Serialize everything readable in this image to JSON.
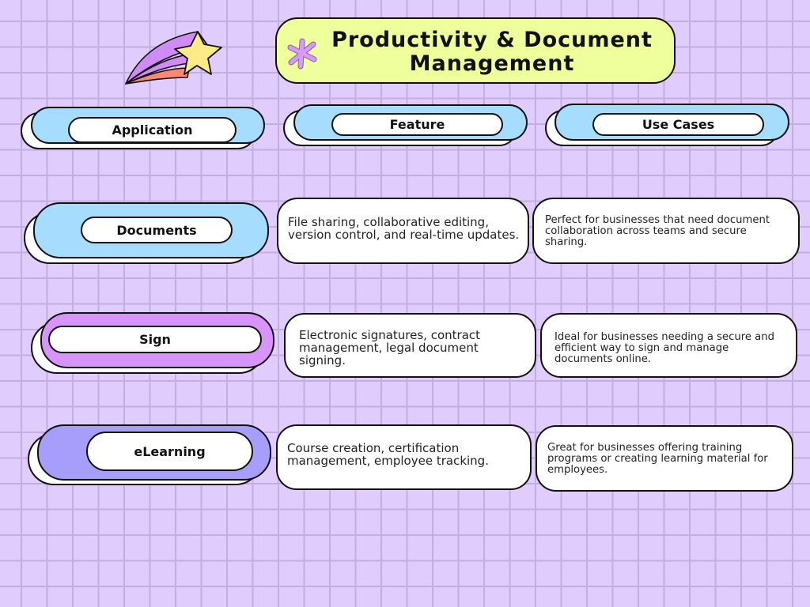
{
  "title": {
    "line1": "Productivity & Document",
    "line2": "Management"
  },
  "decorations": {
    "shooting_star": "shooting-star-icon",
    "asterisk": "asterisk-icon"
  },
  "colors": {
    "background": "#e0ccfd",
    "grid": "#c3aee0",
    "title_bg": "#efff9b",
    "header_blue": "#a6dcfd",
    "sign_purple": "#d794fa",
    "elearning_violet": "#a79dfb",
    "star_yellow": "#ffeb86",
    "tail_purple": "#cf8cf7",
    "tail_coral": "#fb8777"
  },
  "headers": {
    "application": "Application",
    "feature": "Feature",
    "use_cases": "Use Cases"
  },
  "rows": [
    {
      "application": "Documents",
      "feature": "File sharing, collaborative editing, version control, and real-time updates.",
      "use_case": "Perfect for businesses that need document collaboration across teams and secure sharing."
    },
    {
      "application": "Sign",
      "feature": "Electronic signatures, contract management, legal document signing.",
      "use_case": "Ideal for businesses needing a secure and efficient way to sign and manage documents online."
    },
    {
      "application": "eLearning",
      "feature": "Course creation, certification management, employee tracking.",
      "use_case": "Great for businesses offering training programs or creating learning material for employees."
    }
  ]
}
